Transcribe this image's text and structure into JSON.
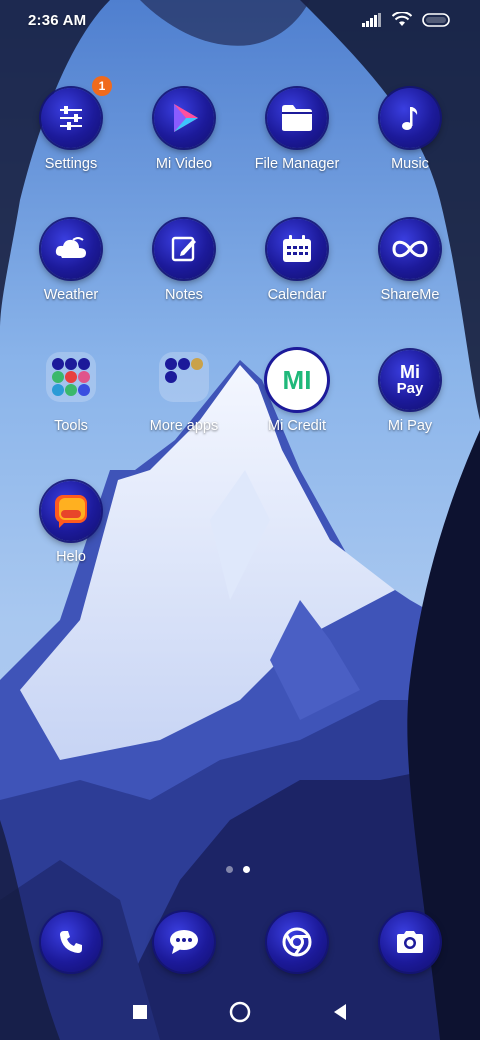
{
  "status_bar": {
    "time": "2:36 AM",
    "icons": [
      "signal-icon",
      "wifi-icon",
      "battery-icon"
    ]
  },
  "apps": [
    {
      "name": "settings",
      "label": "Settings",
      "icon": "sliders-icon",
      "badge": "1"
    },
    {
      "name": "mi-video",
      "label": "Mi Video",
      "icon": "play-icon"
    },
    {
      "name": "file-manager",
      "label": "File Manager",
      "icon": "folder-icon"
    },
    {
      "name": "music",
      "label": "Music",
      "icon": "music-note-icon"
    },
    {
      "name": "weather",
      "label": "Weather",
      "icon": "cloud-icon"
    },
    {
      "name": "notes",
      "label": "Notes",
      "icon": "pencil-icon"
    },
    {
      "name": "calendar",
      "label": "Calendar",
      "icon": "calendar-icon"
    },
    {
      "name": "shareme",
      "label": "ShareMe",
      "icon": "infinity-icon"
    },
    {
      "name": "tools",
      "label": "Tools",
      "icon": "folder-tools-icon"
    },
    {
      "name": "more-apps",
      "label": "More apps",
      "icon": "folder-more-icon"
    },
    {
      "name": "mi-credit",
      "label": "Mi Credit",
      "icon": "mi-credit-icon",
      "icon_text": "MI"
    },
    {
      "name": "mi-pay",
      "label": "Mi Pay",
      "icon": "mi-pay-icon",
      "icon_text": "Mi",
      "icon_subtext": "Pay"
    },
    {
      "name": "helo",
      "label": "Helo",
      "icon": "helo-icon"
    }
  ],
  "page_indicator": {
    "pages": 2,
    "current": 2
  },
  "dock": [
    {
      "name": "phone",
      "icon": "phone-icon"
    },
    {
      "name": "messages",
      "icon": "chat-icon"
    },
    {
      "name": "chrome",
      "icon": "chrome-icon"
    },
    {
      "name": "camera",
      "icon": "camera-icon"
    }
  ],
  "nav_bar": {
    "buttons": [
      "recents-icon",
      "home-icon",
      "back-icon"
    ]
  },
  "colors": {
    "icon_bg": "#1c1a9a",
    "badge": "#f06a1d",
    "sky": "#6d8fd6"
  }
}
